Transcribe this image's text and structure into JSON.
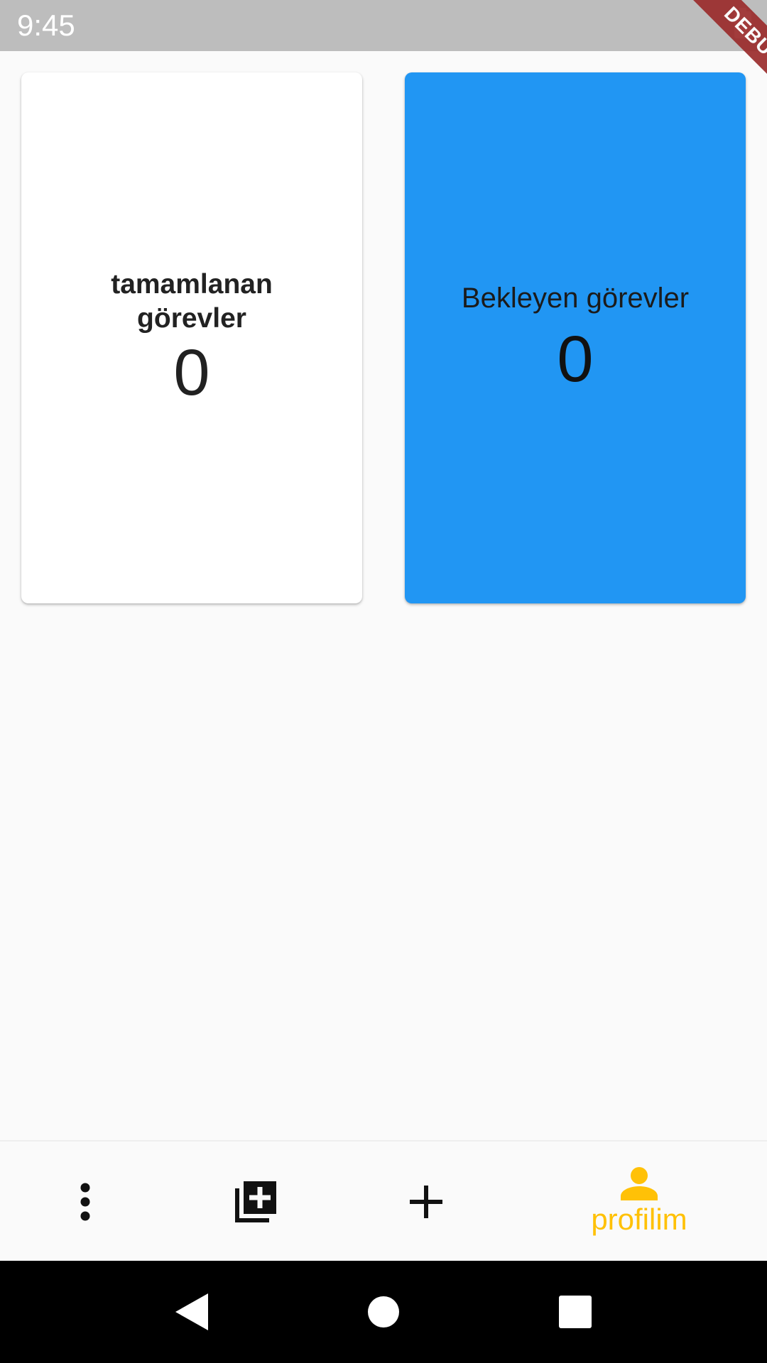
{
  "status_bar": {
    "time": "9:45",
    "debug_label": "DEBUG"
  },
  "cards": {
    "completed": {
      "title": "tamamlanan görevler",
      "count": "0",
      "background": "#ffffff"
    },
    "pending": {
      "title": "Bekleyen görevler",
      "count": "0",
      "background": "#2196f3"
    }
  },
  "bottom_nav": {
    "items": [
      {
        "icon": "more-vert-icon"
      },
      {
        "icon": "library-add-icon"
      },
      {
        "icon": "add-icon"
      },
      {
        "icon": "person-icon",
        "label": "profilim",
        "active": true
      }
    ],
    "active_color": "#ffc107"
  },
  "system_nav": {
    "buttons": [
      "back-icon",
      "home-icon",
      "recents-icon"
    ]
  }
}
